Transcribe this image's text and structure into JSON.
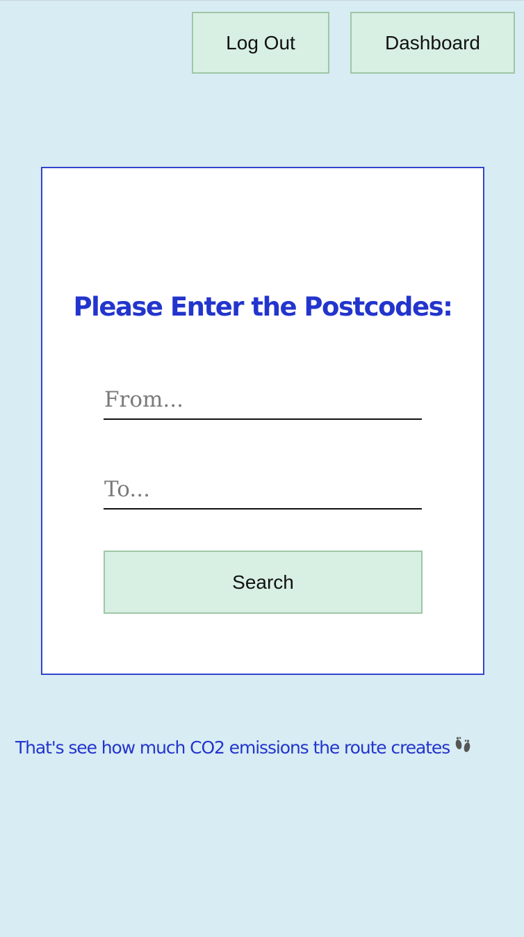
{
  "header": {
    "logout_label": "Log Out",
    "dashboard_label": "Dashboard"
  },
  "form": {
    "title": "Please Enter the Postcodes:",
    "from": {
      "placeholder": "From...",
      "value": ""
    },
    "to": {
      "placeholder": "To...",
      "value": ""
    },
    "search_label": "Search"
  },
  "footer": {
    "tagline": "That's see how much CO2 emissions the route creates",
    "icon": "footprints-icon"
  },
  "colors": {
    "background": "#d8ecf3",
    "accent": "#2335cc",
    "button_bg": "#d8efe4",
    "button_border": "#9fc6a6"
  }
}
